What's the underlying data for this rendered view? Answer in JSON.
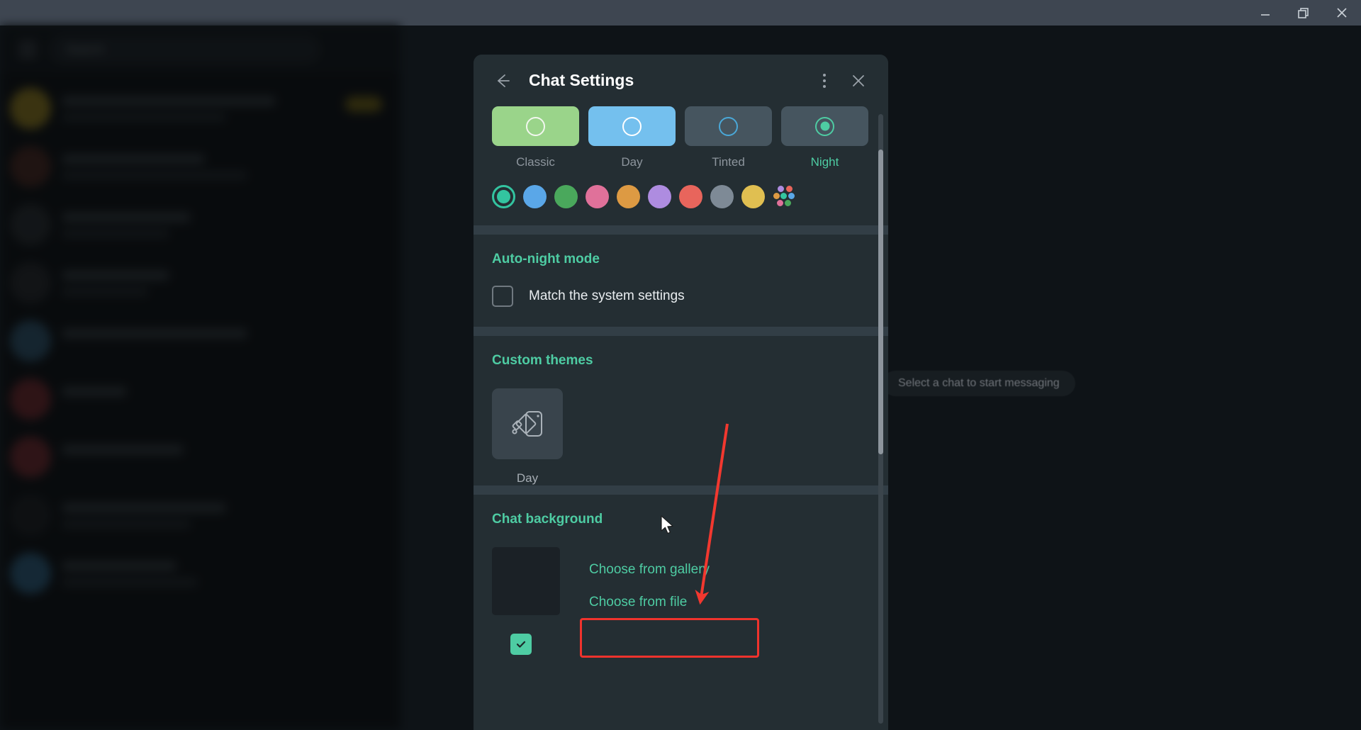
{
  "window": {
    "minimize_label": "Minimize",
    "restore_label": "Restore",
    "close_label": "Close"
  },
  "sidebar": {
    "menu_icon": "hamburger-icon",
    "search_placeholder": "Search",
    "chats": [
      {
        "avatar": "#8a7a28",
        "badge": "#6e6420",
        "l1": 300,
        "l2": 230
      },
      {
        "avatar": "#4a2f2a",
        "badge": "",
        "l1": 200,
        "l2": 260
      },
      {
        "avatar": "#2c3338",
        "badge": "",
        "l1": 180,
        "l2": 150
      },
      {
        "avatar": "#2a2f34",
        "badge": "",
        "l1": 150,
        "l2": 120
      },
      {
        "avatar": "#32576f",
        "badge": "",
        "l1": 260,
        "l2": 0
      },
      {
        "avatar": "#6e2f35",
        "badge": "",
        "l1": 90,
        "l2": 0
      },
      {
        "avatar": "#6e3036",
        "badge": "",
        "l1": 170,
        "l2": 0
      },
      {
        "avatar": "#22272c",
        "badge": "",
        "l1": 230,
        "l2": 180
      },
      {
        "avatar": "#31607f",
        "badge": "",
        "l1": 160,
        "l2": 190
      }
    ]
  },
  "empty_state": {
    "hint": "Select a chat to start messaging"
  },
  "dialog": {
    "title": "Chat Settings",
    "back_icon": "arrow-left-icon",
    "menu_icon": "more-vertical-icon",
    "close_icon": "close-icon",
    "themes": {
      "items": [
        {
          "label": "Classic",
          "card_bg": "#9ad48a",
          "ring": "#f2f7ef",
          "selected": false
        },
        {
          "label": "Day",
          "card_bg": "#74c0ee",
          "ring": "#ffffff",
          "selected": false
        },
        {
          "label": "Tinted",
          "card_bg": "#46555f",
          "ring": "#4aa8d8",
          "selected": false
        },
        {
          "label": "Night",
          "card_bg": "#46555f",
          "ring": "#4ecca3",
          "selected": true
        }
      ]
    },
    "accents": {
      "swatches": [
        {
          "name": "teal",
          "color": "#33c4a0",
          "selected": true
        },
        {
          "name": "blue",
          "color": "#5aa7e8",
          "selected": false
        },
        {
          "name": "green",
          "color": "#4aa85c",
          "selected": false
        },
        {
          "name": "pink",
          "color": "#e0719a",
          "selected": false
        },
        {
          "name": "orange",
          "color": "#dd9a43",
          "selected": false
        },
        {
          "name": "purple",
          "color": "#ae8ce0",
          "selected": false
        },
        {
          "name": "red",
          "color": "#e8655c",
          "selected": false
        },
        {
          "name": "gray",
          "color": "#7e8a96",
          "selected": false
        },
        {
          "name": "yellow",
          "color": "#e0bf51",
          "selected": false
        }
      ],
      "multicolor": {
        "name": "multicolor-palette",
        "dots": [
          "#ae8ce0",
          "#e8655c",
          "#dd9a43",
          "#33c4a0",
          "#5aa7e8",
          "#e0719a",
          "#4aa85c"
        ]
      }
    },
    "auto_night": {
      "title": "Auto-night mode",
      "option_label": "Match the system settings",
      "checked": false
    },
    "custom_themes": {
      "title": "Custom themes",
      "items": [
        {
          "label": "Day",
          "icon": "theme-brush-icon"
        }
      ]
    },
    "chat_background": {
      "title": "Chat background",
      "thumb_color": "#1b2126",
      "choose_gallery_label": "Choose from gallery",
      "choose_file_label": "Choose from file",
      "bottom_option_checked": true
    },
    "scrollbar": {
      "name": "vertical-scrollbar"
    }
  },
  "annotation": {
    "highlight_color": "#f0332d",
    "arrow_color": "#f2382f",
    "target": "Choose from gallery"
  },
  "colors": {
    "accent": "#4ecca3",
    "dialog_bg": "#242e33",
    "divider": "#323e46",
    "titlebar": "#3e4651"
  }
}
